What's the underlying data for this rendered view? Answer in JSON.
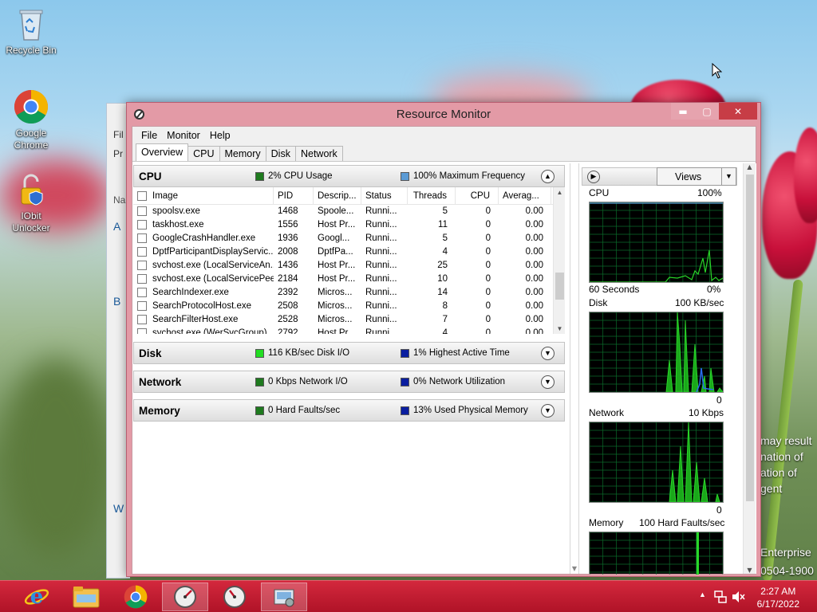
{
  "desktop": {
    "icons": [
      {
        "label": "Recycle Bin"
      },
      {
        "label": "Google Chrome"
      },
      {
        "label": "IObit Unlocker"
      }
    ],
    "right_text": [
      "may result",
      "nation of",
      "ation of",
      "gent",
      "Enterprise",
      "0504-1900"
    ]
  },
  "bg_window": {
    "fragments": [
      "Fil",
      "Pr",
      "Na",
      "A",
      "B",
      "W"
    ]
  },
  "window": {
    "title": "Resource Monitor",
    "menu": [
      "File",
      "Monitor",
      "Help"
    ],
    "tabs": [
      "Overview",
      "CPU",
      "Memory",
      "Disk",
      "Network"
    ],
    "active_tab": "Overview"
  },
  "cpu": {
    "name": "CPU",
    "stat1": "2% CPU Usage",
    "stat2": "100% Maximum Frequency",
    "columns": [
      "Image",
      "PID",
      "Descrip...",
      "Status",
      "Threads",
      "CPU",
      "Averag..."
    ],
    "rows": [
      [
        "spoolsv.exe",
        "1468",
        "Spoole...",
        "Runni...",
        "5",
        "0",
        "0.00"
      ],
      [
        "taskhost.exe",
        "1556",
        "Host Pr...",
        "Runni...",
        "11",
        "0",
        "0.00"
      ],
      [
        "GoogleCrashHandler.exe",
        "1936",
        "Googl...",
        "Runni...",
        "5",
        "0",
        "0.00"
      ],
      [
        "DptfParticipantDisplayServic...",
        "2008",
        "DptfPa...",
        "Runni...",
        "4",
        "0",
        "0.00"
      ],
      [
        "svchost.exe (LocalServiceAn...",
        "1436",
        "Host Pr...",
        "Runni...",
        "25",
        "0",
        "0.00"
      ],
      [
        "svchost.exe (LocalServicePee...",
        "2184",
        "Host Pr...",
        "Runni...",
        "10",
        "0",
        "0.00"
      ],
      [
        "SearchIndexer.exe",
        "2392",
        "Micros...",
        "Runni...",
        "14",
        "0",
        "0.00"
      ],
      [
        "SearchProtocolHost.exe",
        "2508",
        "Micros...",
        "Runni...",
        "8",
        "0",
        "0.00"
      ],
      [
        "SearchFilterHost.exe",
        "2528",
        "Micros...",
        "Runni...",
        "7",
        "0",
        "0.00"
      ],
      [
        "svchost.exe (WerSvcGroup)",
        "2792",
        "Host Pr...",
        "Runni...",
        "4",
        "0",
        "0.00"
      ]
    ]
  },
  "disk": {
    "name": "Disk",
    "stat1": "116 KB/sec Disk I/O",
    "stat2": "1% Highest Active Time"
  },
  "network": {
    "name": "Network",
    "stat1": "0 Kbps Network I/O",
    "stat2": "0% Network Utilization"
  },
  "memory": {
    "name": "Memory",
    "stat1": "0 Hard Faults/sec",
    "stat2": "13% Used Physical Memory"
  },
  "graphs": {
    "views_label": "Views",
    "cpu": {
      "label": "CPU",
      "max": "100%",
      "time": "60 Seconds",
      "min": "0%"
    },
    "disk": {
      "label": "Disk",
      "max": "100 KB/sec",
      "min": "0"
    },
    "network": {
      "label": "Network",
      "max": "10 Kbps",
      "min": "0"
    },
    "memory": {
      "label": "Memory",
      "max": "100 Hard Faults/sec"
    }
  },
  "colors": {
    "cpu_usage": "#1e7a1e",
    "max_freq": "#5b9bd5",
    "disk_io": "#22dd22",
    "active_time": "#0a1ea0",
    "network_io": "#1e7a1e",
    "utilization": "#0a1ea0",
    "hard_faults": "#1e7a1e",
    "used_memory": "#0a1ea0",
    "graph_line": "#29d629",
    "taskbar": "#c01a30"
  },
  "taskbar": {
    "items": [
      "internet-explorer",
      "file-explorer",
      "google-chrome",
      "resource-monitor",
      "performance-monitor",
      "system-tool"
    ],
    "time": "2:27 AM",
    "date": "6/17/2022"
  }
}
